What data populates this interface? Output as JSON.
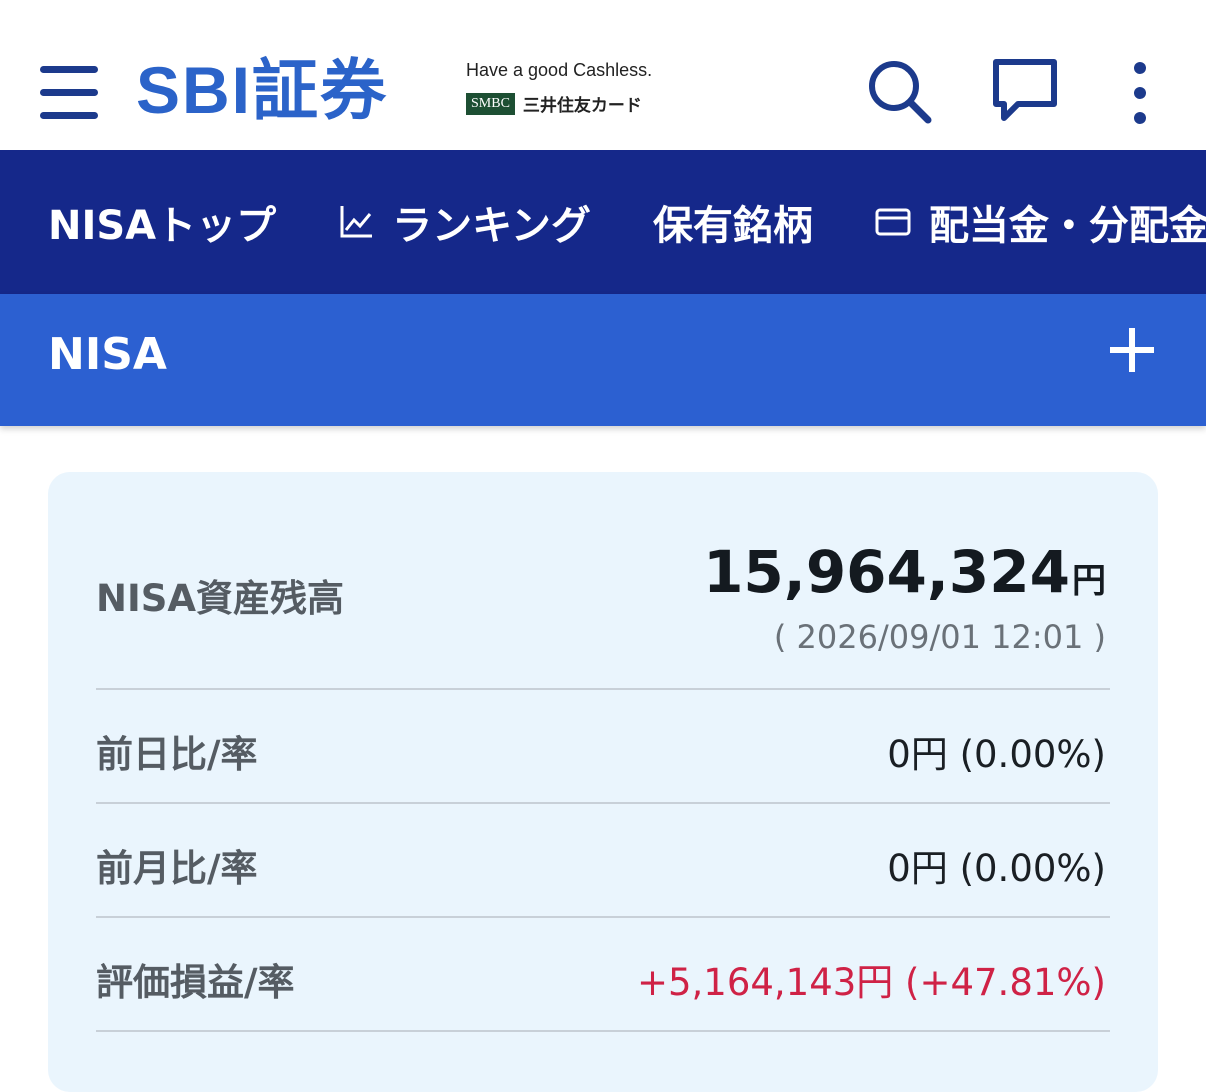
{
  "header": {
    "logo": "SBI証券",
    "ad_tagline": "Have a good Cashless.",
    "ad_badge": "SMBC",
    "ad_card": "三井住友カード"
  },
  "nav": {
    "items": [
      {
        "label": "NISAトップ",
        "icon": null
      },
      {
        "label": "ランキング",
        "icon": "chart-icon"
      },
      {
        "label": "保有銘柄",
        "icon": null
      },
      {
        "label": "配当金・分配金",
        "icon": "card-icon"
      }
    ]
  },
  "section": {
    "title": "NISA",
    "expand_icon": "plus-icon"
  },
  "summary": {
    "balance_label": "NISA資産残高",
    "balance_value": "15,964,324",
    "balance_unit": "円",
    "timestamp": "( 2026/09/01 12:01 )",
    "rows": [
      {
        "label": "前日比/率",
        "value": "0円 (0.00%)"
      },
      {
        "label": "前月比/率",
        "value": "0円 (0.00%)"
      },
      {
        "label": "評価損益/率",
        "value": "+5,164,143円 (+47.81%)"
      }
    ]
  },
  "colors": {
    "brand_blue": "#2b63c9",
    "nav_bg": "#15288a",
    "section_bg": "#2c60d1",
    "card_bg": "#eaf5fd",
    "positive": "#cf2246"
  }
}
